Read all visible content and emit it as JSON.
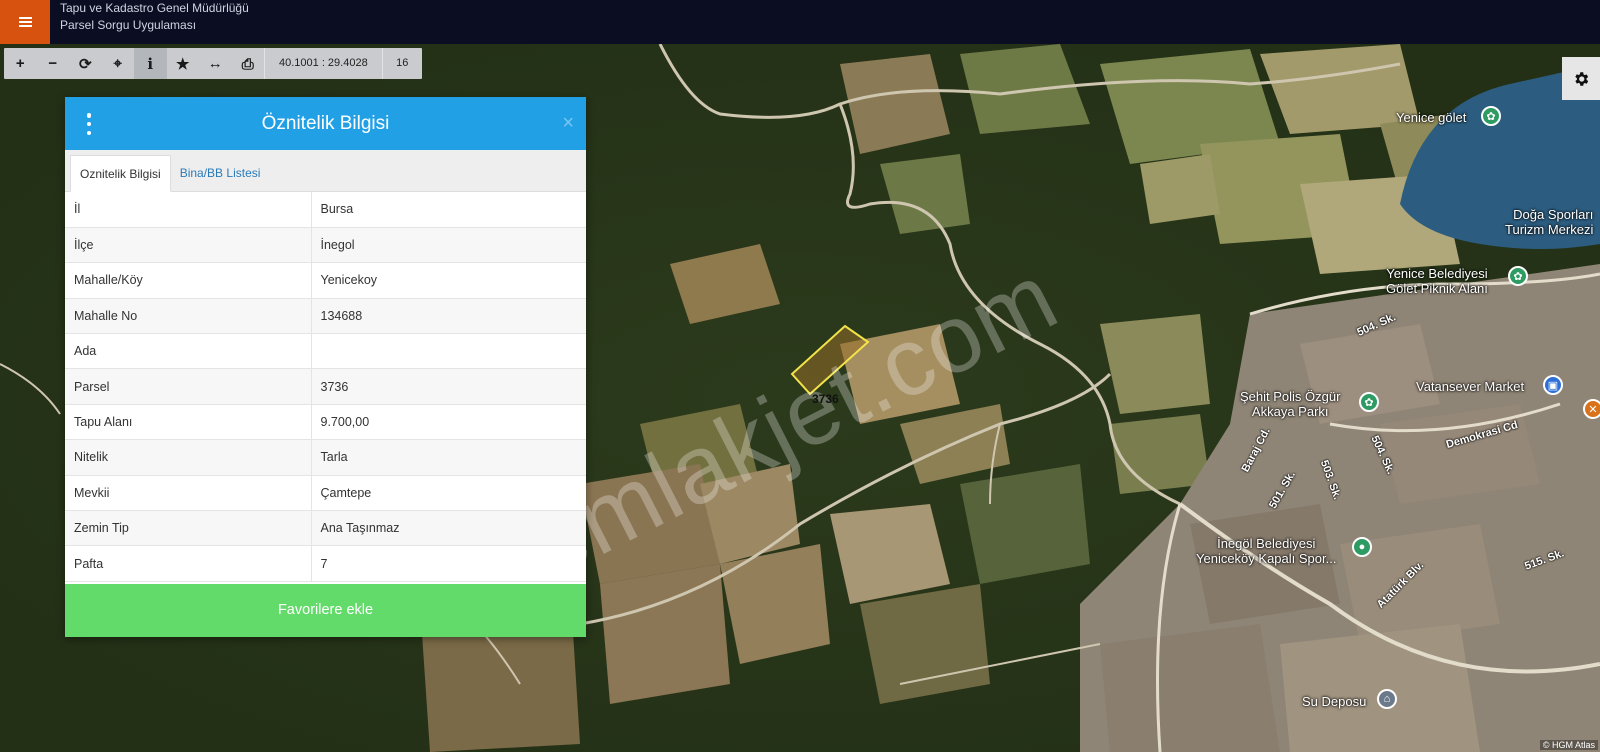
{
  "header": {
    "org_title": "Tapu ve Kadastro Genel Müdürlüğü",
    "app_title": "Parsel Sorgu Uygulaması",
    "menu_color": "#d7520f"
  },
  "toolbar": {
    "tools": [
      {
        "name": "zoom-in",
        "glyph": "+"
      },
      {
        "name": "zoom-out",
        "glyph": "−"
      },
      {
        "name": "refresh",
        "glyph": "⟳"
      },
      {
        "name": "locate",
        "glyph": "⌖"
      },
      {
        "name": "info",
        "glyph": "i"
      },
      {
        "name": "favorites",
        "glyph": "★"
      },
      {
        "name": "measure",
        "glyph": "↔"
      },
      {
        "name": "print",
        "glyph": "⎙"
      }
    ],
    "coordinates": "40.1001 : 29.4028",
    "zoom_level": "16"
  },
  "panel": {
    "title": "Öznitelik Bilgisi",
    "close_glyph": "×",
    "tabs": [
      {
        "label": "Oznitelik Bilgisi",
        "active": true
      },
      {
        "label": "Bina/BB Listesi",
        "active": false
      }
    ],
    "rows": [
      {
        "key": "İl",
        "value": "Bursa"
      },
      {
        "key": "İlçe",
        "value": "İnegol"
      },
      {
        "key": "Mahalle/Köy",
        "value": "Yenicekoy"
      },
      {
        "key": "Mahalle No",
        "value": "134688"
      },
      {
        "key": "Ada",
        "value": ""
      },
      {
        "key": "Parsel",
        "value": "3736"
      },
      {
        "key": "Tapu Alanı",
        "value": "9.700,00"
      },
      {
        "key": "Nitelik",
        "value": "Tarla"
      },
      {
        "key": "Mevkii",
        "value": "Çamtepe"
      },
      {
        "key": "Zemin Tip",
        "value": "Ana Taşınmaz"
      },
      {
        "key": "Pafta",
        "value": "7"
      }
    ],
    "favorite_button": "Favorilere ekle",
    "header_color": "#22a0e6",
    "button_color": "#62db6a"
  },
  "map": {
    "watermark": "emlakjet.com",
    "parcel_label": "3736",
    "attribution": "© HGM Atlas",
    "places": [
      {
        "name": "Yenice gölet"
      },
      {
        "name": "Doğa Sporları\nTurizm Merkezi"
      },
      {
        "name": "Yenice Belediyesi\nGölet Piknik Alanı"
      },
      {
        "name": "Vatansever Market"
      },
      {
        "name": "Şehit Polis Özgür\nAkkaya Parkı"
      },
      {
        "name": "İnegöl Belediyesi\nYeniceköy Kapalı Spor..."
      },
      {
        "name": "Su Deposu"
      }
    ],
    "roads": [
      "504. Sk.",
      "504. Sk.",
      "Demokrasi Cd",
      "Baraj Cd.",
      "501. Sk.",
      "503. Sk.",
      "515. Sk.",
      "Atatürk Blv."
    ]
  }
}
